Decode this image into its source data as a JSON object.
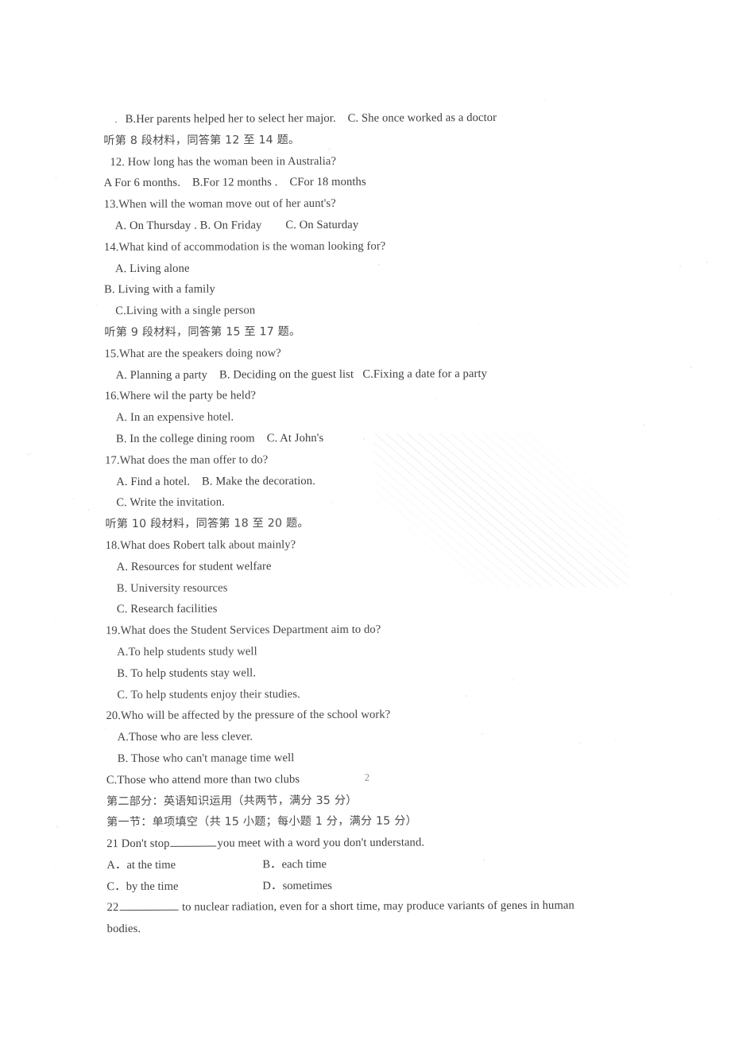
{
  "document": {
    "type": "scanned-exam-paper",
    "page_number": "2",
    "language_mix": [
      "English",
      "Chinese"
    ]
  },
  "lines": [
    {
      "id": "l01",
      "indent": 2,
      "lead_dot": true,
      "text": "B.Her parents helped her to select her major.    C. She once worked as a doctor"
    },
    {
      "id": "l02",
      "indent": 0,
      "chinese": true,
      "text": "听第 8 段材料，同答第 12 至 14 题。"
    },
    {
      "id": "l03",
      "indent": 1,
      "text": "12. How long has the woman been in Australia?"
    },
    {
      "id": "l04",
      "indent": 0,
      "text": "A For 6 months.    B.For 12 months .    CFor 18 months"
    },
    {
      "id": "l05",
      "indent": 0,
      "text": "13.When will the woman move out of her aunt's?"
    },
    {
      "id": "l06",
      "indent": 2,
      "text": "A. On Thursday . B. On Friday        C. On Saturday"
    },
    {
      "id": "l07",
      "indent": 0,
      "text": "14.What kind of accommodation is the woman looking for?"
    },
    {
      "id": "l08",
      "indent": 2,
      "text": "A. Living alone"
    },
    {
      "id": "l09",
      "indent": 0,
      "text": "B. Living with a family"
    },
    {
      "id": "l10",
      "indent": 2,
      "text": "C.Living with a single person"
    },
    {
      "id": "l11",
      "indent": 0,
      "chinese": true,
      "text": "听第 9 段材料，同答第 15 至 17 题。"
    },
    {
      "id": "l12",
      "indent": 0,
      "text": "15.What are the speakers doing now?"
    },
    {
      "id": "l13",
      "indent": 2,
      "text": "A. Planning a party    B. Deciding on the guest list   C.Fixing a date for a party"
    },
    {
      "id": "l14",
      "indent": 0,
      "text": "16.Where wil the party be held?"
    },
    {
      "id": "l15",
      "indent": 2,
      "text": "A. In an expensive hotel."
    },
    {
      "id": "l16",
      "indent": 2,
      "text": "B. In the college dining room    C. At John's"
    },
    {
      "id": "l17",
      "indent": 0,
      "text": "17.What does the man offer to do?"
    },
    {
      "id": "l18",
      "indent": 2,
      "text": "A. Find a hotel.    B. Make the decoration."
    },
    {
      "id": "l19",
      "indent": 2,
      "text": "C. Write the invitation."
    },
    {
      "id": "l20",
      "indent": 0,
      "chinese": true,
      "text": "听第 10 段材料，同答第 18 至 20 题。"
    },
    {
      "id": "l21",
      "indent": 0,
      "text": "18.What does Robert talk about mainly?"
    },
    {
      "id": "l22",
      "indent": 2,
      "text": "A. Resources for student welfare"
    },
    {
      "id": "l23",
      "indent": 2,
      "text": "B. University resources"
    },
    {
      "id": "l24",
      "indent": 2,
      "text": "C. Research facilities"
    },
    {
      "id": "l25",
      "indent": 0,
      "text": "19.What does the Student Services Department aim to do?"
    },
    {
      "id": "l26",
      "indent": 2,
      "text": "A.To help students study well"
    },
    {
      "id": "l27",
      "indent": 2,
      "text": "B. To help students stay well."
    },
    {
      "id": "l28",
      "indent": 2,
      "text": "C. To help students enjoy their studies."
    },
    {
      "id": "l29",
      "indent": 0,
      "text": "20.Who will be affected by the pressure of the school work?"
    },
    {
      "id": "l30",
      "indent": 2,
      "text": "A.Those who are less clever."
    },
    {
      "id": "l31",
      "indent": 2,
      "text": "B. Those who can't manage time well"
    },
    {
      "id": "l32",
      "indent": 0,
      "text": "C.Those who attend more than two clubs"
    },
    {
      "id": "l33",
      "indent": 0,
      "chinese": true,
      "text": "第二部分：英语知识运用（共两节，满分 35 分）"
    },
    {
      "id": "l34",
      "indent": 0,
      "chinese": true,
      "text": "第一节：单项填空（共 15 小题；每小题 1 分，满分 15 分）"
    }
  ],
  "question21": {
    "number_and_stem_before_blank": "21 Don't stop",
    "stem_after_blank": "you meet with a word you don't understand.",
    "options": {
      "a": "A．at the time",
      "b": "B．each time",
      "c": "C．by the time",
      "d": "D．sometimes"
    }
  },
  "question22": {
    "number": "22",
    "text_after_blank": " to nuclear radiation, even for a short time, may produce variants of genes in human",
    "continuation": "bodies."
  },
  "footer": {
    "page_number": "2"
  }
}
